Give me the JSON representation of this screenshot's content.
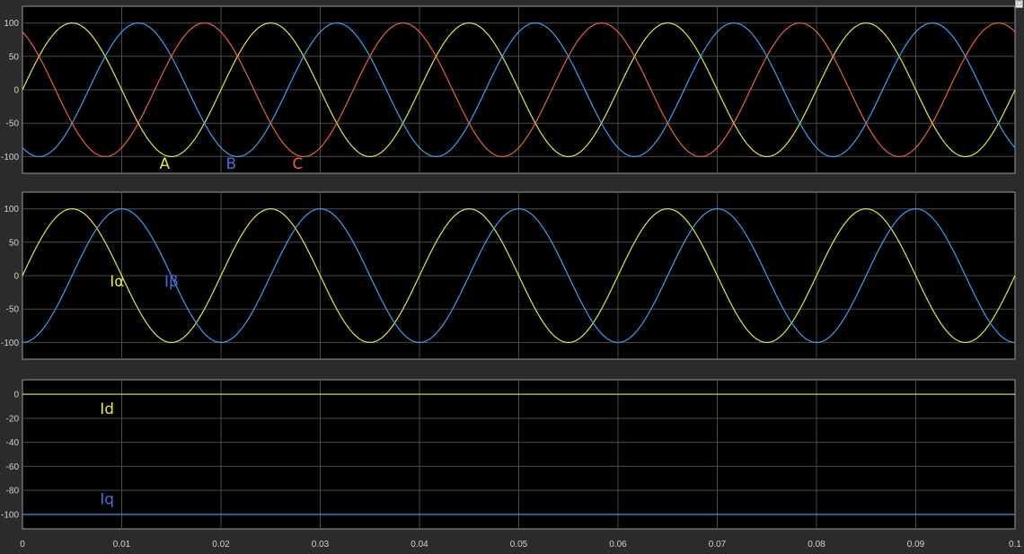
{
  "chart_data": [
    {
      "type": "line",
      "title": "",
      "xlabel": "",
      "ylabel": "",
      "xlim": [
        0,
        0.1
      ],
      "ylim": [
        -125,
        125
      ],
      "yticks": [
        100,
        50,
        0,
        -50,
        -100
      ],
      "grid": true,
      "series": [
        {
          "name": "A",
          "function": "sine",
          "amplitude": 100,
          "frequency_hz": 50,
          "phase_deg": 0,
          "color": "#e6e63c"
        },
        {
          "name": "B",
          "function": "sine",
          "amplitude": 100,
          "frequency_hz": 50,
          "phase_deg": -120,
          "color": "#3aa0f0"
        },
        {
          "name": "C",
          "function": "sine",
          "amplitude": 100,
          "frequency_hz": 50,
          "phase_deg": 120,
          "color": "#e8613f"
        }
      ],
      "annotations": [
        {
          "text": "A",
          "x": 0.0138,
          "y": -110,
          "color": "#e6e63c"
        },
        {
          "text": "B",
          "x": 0.0205,
          "y": -110,
          "color": "#4a6bdc"
        },
        {
          "text": "C",
          "x": 0.0272,
          "y": -110,
          "color": "#e8613f"
        }
      ]
    },
    {
      "type": "line",
      "title": "",
      "xlabel": "",
      "ylabel": "",
      "xlim": [
        0,
        0.1
      ],
      "ylim": [
        -125,
        125
      ],
      "yticks": [
        100,
        50,
        0,
        -50,
        -100
      ],
      "grid": true,
      "series": [
        {
          "name": "Iα",
          "function": "sine",
          "amplitude": 100,
          "frequency_hz": 50,
          "phase_deg": 0,
          "color": "#e6e63c"
        },
        {
          "name": "Iβ",
          "function": "sine",
          "amplitude": 100,
          "frequency_hz": 50,
          "phase_deg": -90,
          "color": "#3aa0f0"
        }
      ],
      "annotations": [
        {
          "text": "Iα",
          "x": 0.0088,
          "y": -8,
          "color": "#e6e63c"
        },
        {
          "text": "Iβ",
          "x": 0.0143,
          "y": -8,
          "color": "#4a6bdc"
        }
      ]
    },
    {
      "type": "line",
      "title": "",
      "xlabel": "",
      "ylabel": "",
      "xlim": [
        0,
        0.1
      ],
      "ylim": [
        -112,
        12
      ],
      "yticks": [
        0,
        -20,
        -40,
        -60,
        -80,
        -100
      ],
      "xticks": [
        0,
        0.01,
        0.02,
        0.03,
        0.04,
        0.05,
        0.06,
        0.07,
        0.08,
        0.09,
        0.1
      ],
      "xticklabels": [
        "0",
        "0.01",
        "0.02",
        "0.03",
        "0.04",
        "0.05",
        "0.06",
        "0.07",
        "0.08",
        "0.09",
        "0.1"
      ],
      "grid": true,
      "series": [
        {
          "name": "Id",
          "function": "constant",
          "value": 0,
          "color": "#e6e63c"
        },
        {
          "name": "Iq",
          "function": "constant",
          "value": -100,
          "color": "#3aa0f0"
        }
      ],
      "annotations": [
        {
          "text": "Id",
          "x": 0.0078,
          "y": -12,
          "color": "#e6e63c"
        },
        {
          "text": "Iq",
          "x": 0.0078,
          "y": -87,
          "color": "#4a6bdc"
        }
      ]
    }
  ]
}
